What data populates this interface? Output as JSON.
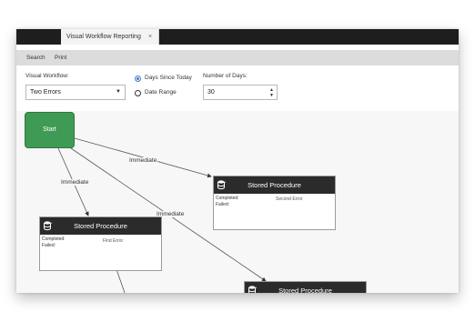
{
  "tab": {
    "title": "Visual Workflow Reporting",
    "close": "×"
  },
  "menu": {
    "search": "Search",
    "print": "Print"
  },
  "filters": {
    "workflow_label": "Visual Workflow:",
    "workflow_value": "Two Errors",
    "radio_days_label": "Days Since Today",
    "radio_range_label": "Date Range",
    "days_label": "Number of Days:",
    "days_value": "30"
  },
  "canvas": {
    "start_label": "Start",
    "edge_labels": [
      "Immediate",
      "Immediate",
      "Immediate"
    ],
    "procedures": [
      {
        "title": "Stored Procedure",
        "completed": "Completed:",
        "failed": "Failed:",
        "error": "Second Error"
      },
      {
        "title": "Stored Procedure",
        "completed": "Completed:",
        "failed": "Failed:",
        "error": "First Error"
      },
      {
        "title": "Stored Procedure"
      }
    ]
  }
}
